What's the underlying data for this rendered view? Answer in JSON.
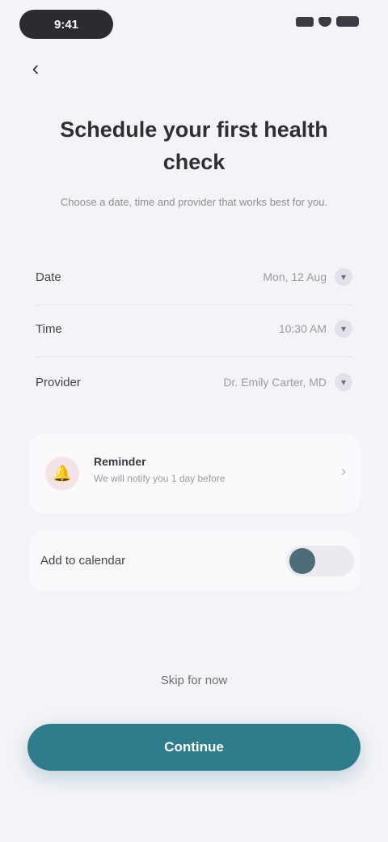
{
  "status_bar": {
    "time": "9:41"
  },
  "header": {
    "back_icon": "chevron-left-icon"
  },
  "title": "Schedule your first health check",
  "subtitle": "Choose a date, time and provider that works best for you.",
  "form": {
    "rows": [
      {
        "label": "Date",
        "value": "Mon, 12 Aug"
      },
      {
        "label": "Time",
        "value": "10:30 AM"
      },
      {
        "label": "Provider",
        "value": "Dr. Emily Carter, MD"
      }
    ]
  },
  "reminder": {
    "title": "Reminder",
    "description": "We will notify you 1 day before",
    "icon": "bell-icon"
  },
  "toggle": {
    "label": "Add to calendar",
    "on": true
  },
  "skip_label": "Skip for now",
  "primary_button_label": "Continue",
  "colors": {
    "primary": "#2f7d8c",
    "background": "#f4f3f8",
    "accent_soft": "#f4e4e6"
  }
}
